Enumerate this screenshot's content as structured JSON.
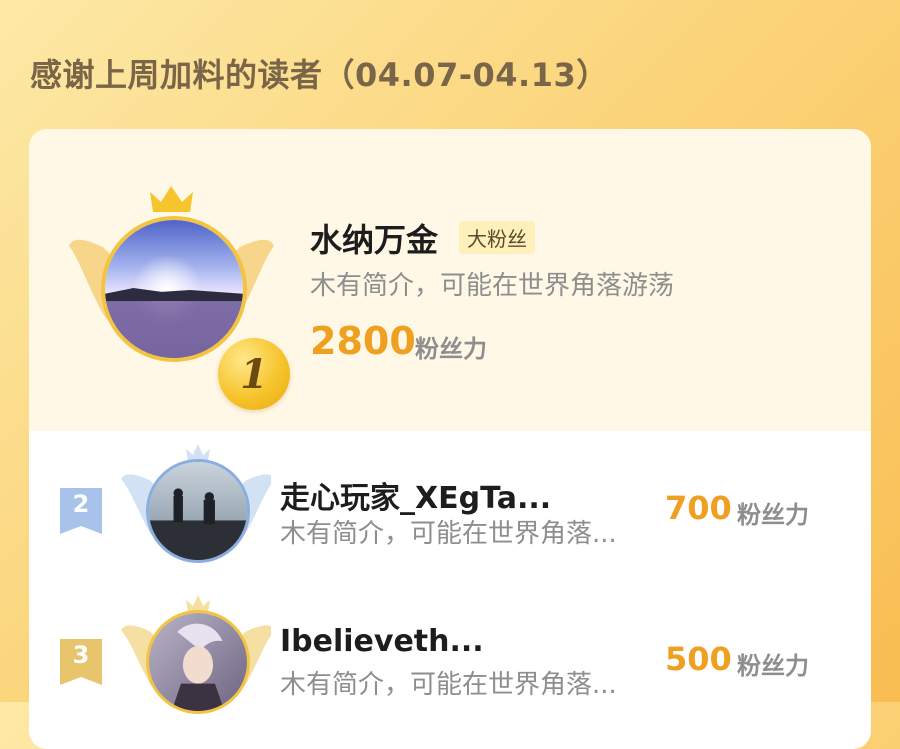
{
  "header": {
    "title": "感谢上周加料的读者（04.07-04.13）"
  },
  "leaderboard": {
    "first": {
      "rank": "1",
      "name": "水纳万金",
      "tag": "大粉丝",
      "bio": "木有简介，可能在世界角落游荡",
      "score": "2800",
      "unit": "粉丝力"
    },
    "others": [
      {
        "rank": "2",
        "name": "走心玩家_XEgTa...",
        "bio": "木有简介，可能在世界角落...",
        "score": "700",
        "unit": "粉丝力"
      },
      {
        "rank": "3",
        "name": "Ibelieveth...",
        "bio": "木有简介，可能在世界角落...",
        "score": "500",
        "unit": "粉丝力"
      }
    ]
  },
  "colors": {
    "accent": "#f0a020",
    "gold": "#f3c441",
    "silver": "#8aaee0",
    "bronze": "#e8c56c"
  }
}
